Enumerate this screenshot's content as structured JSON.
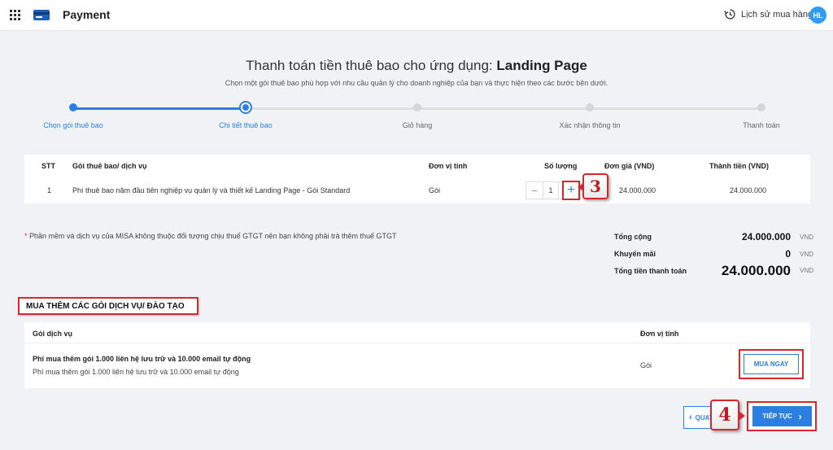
{
  "header": {
    "app_title": "Payment",
    "history_label": "Lịch sử mua hàng",
    "avatar_initials": "HL",
    "accent_color": "#2b7fe0"
  },
  "page": {
    "title_prefix": "Thanh toán tiền thuê bao cho ứng dụng:",
    "title_app": "Landing Page",
    "subtitle": "Chọn một gói thuê bao phù hợp với nhu cầu quản lý cho doanh nghiệp của bạn và thực hiện theo các bước bên dưới."
  },
  "steps": [
    {
      "label": "Chọn gói thuê bao",
      "state": "done"
    },
    {
      "label": "Chi tiết thuê bao",
      "state": "current"
    },
    {
      "label": "Giỏ hàng",
      "state": "todo"
    },
    {
      "label": "Xác nhận thông tin",
      "state": "todo"
    },
    {
      "label": "Thanh toán",
      "state": "todo"
    }
  ],
  "order_table": {
    "headers": {
      "stt": "STT",
      "package": "Gói thuê bao/ dịch vụ",
      "unit": "Đơn vị tính",
      "quantity": "Số lượng",
      "price": "Đơn giá (VND)",
      "amount": "Thành tiền (VND)"
    },
    "rows": [
      {
        "stt": "1",
        "package": "Phí thuê bao năm đầu tiên nghiệp vụ quản lý và thiết kế Landing Page - Gói Standard",
        "unit": "Gói",
        "quantity": "1",
        "price": "24.000.000",
        "amount": "24.000.000"
      }
    ],
    "minus_symbol": "−",
    "plus_symbol": "+"
  },
  "callouts": {
    "step3": "3",
    "step4": "4"
  },
  "vat_note": {
    "star": "*",
    "text": " Phần mềm và dịch vụ của MISA không thuộc đối tượng chịu thuế GTGT nên bạn không phải trả thêm thuế GTGT"
  },
  "totals": {
    "unit": "VND",
    "subtotal_label": "Tổng cộng",
    "subtotal_value": "24.000.000",
    "discount_label": "Khuyến mãi",
    "discount_value": "0",
    "grand_label": "Tổng tiền thanh toán",
    "grand_value": "24.000.000"
  },
  "addons": {
    "section_title": "MUA THÊM CÁC GÓI DỊCH VỤ/ ĐÀO TẠO",
    "col_service": "Gói dịch vụ",
    "col_unit": "Đơn vị tính",
    "item": {
      "name": "Phí mua thêm gói 1.000 liên hệ lưu trữ và 10.000 email tự động",
      "description": "Phí mua thêm gói 1.000 liên hệ lưu trữ và 10.000 email tự động",
      "unit": "Gói",
      "buy_label": "MUA NGAY"
    }
  },
  "footer": {
    "back_label": "QUAY LẠI",
    "next_label": "TIẾP TỤC"
  }
}
